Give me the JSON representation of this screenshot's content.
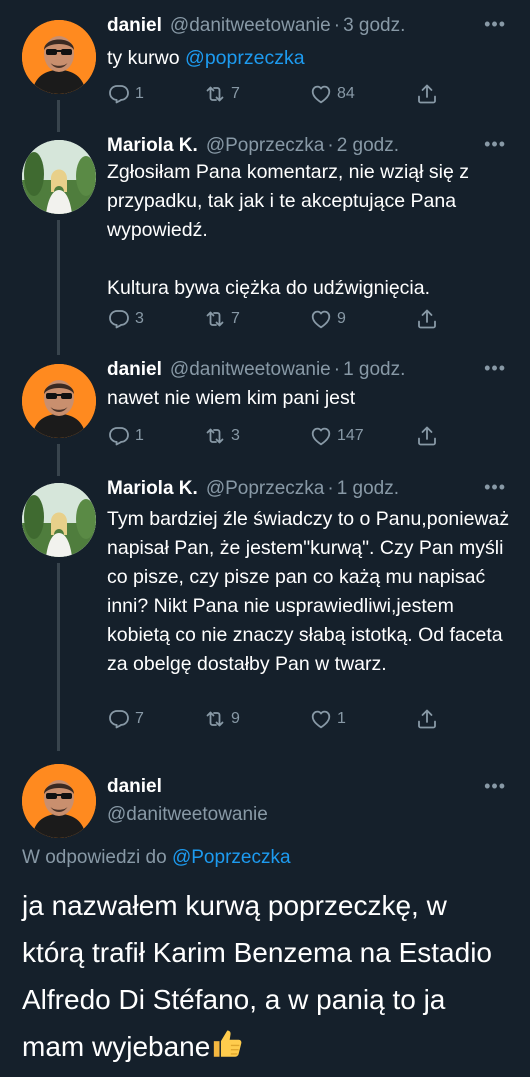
{
  "tweets": [
    {
      "name": "daniel",
      "handle": "@danitweetowanie",
      "sep": "·",
      "time": "3 godz.",
      "text_prefix": "ty kurwo ",
      "mention": "@poprzeczka",
      "replies": "1",
      "retweets": "7",
      "likes": "84"
    },
    {
      "name": "Mariola K.",
      "handle": "@Poprzeczka",
      "sep": "·",
      "time": "2 godz.",
      "paragraph1": "Zgłosiłam Pana komentarz, nie wziął się z przypadku, tak jak i te akceptujące Pana wypowiedź.",
      "paragraph2": "Kultura bywa ciężka do udźwignięcia.",
      "replies": "3",
      "retweets": "7",
      "likes": "9"
    },
    {
      "name": "daniel",
      "handle": "@danitweetowanie",
      "sep": "·",
      "time": "1 godz.",
      "text": "nawet nie wiem kim pani jest",
      "replies": "1",
      "retweets": "3",
      "likes": "147"
    },
    {
      "name": "Mariola K.",
      "handle": "@Poprzeczka",
      "sep": "·",
      "time": "1 godz.",
      "text": "Tym bardziej źle świadczy to o Panu,ponieważ napisał Pan, że jestem\"kurwą\". Czy Pan myśli co pisze, czy pisze pan co każą mu napisać inni? Nikt Pana nie usprawiedliwi,jestem kobietą co nie znaczy słabą istotką. Od faceta za obelgę dostałby Pan w twarz.",
      "replies": "7",
      "retweets": "9",
      "likes": "1"
    }
  ],
  "main_tweet": {
    "name": "daniel",
    "handle": "@danitweetowanie",
    "reply_label": "W odpowiedzi do ",
    "reply_mention": "@Poprzeczka",
    "text": "ja nazwałem kurwą poprzeczkę, w którą trafił Karim Benzema na Estadio Alfredo Di Stéfano, a w panią to ja mam wyjebane"
  },
  "more_label": "•••",
  "icons": {
    "reply": "reply-icon",
    "retweet": "retweet-icon",
    "like": "heart-icon",
    "share": "share-icon",
    "thumb": "thumbs-up-emoji-icon"
  },
  "colors": {
    "background": "#15202b",
    "text": "#ffffff",
    "secondary": "#8899a6",
    "link": "#1d9bf0",
    "thread_line": "#38444d"
  }
}
